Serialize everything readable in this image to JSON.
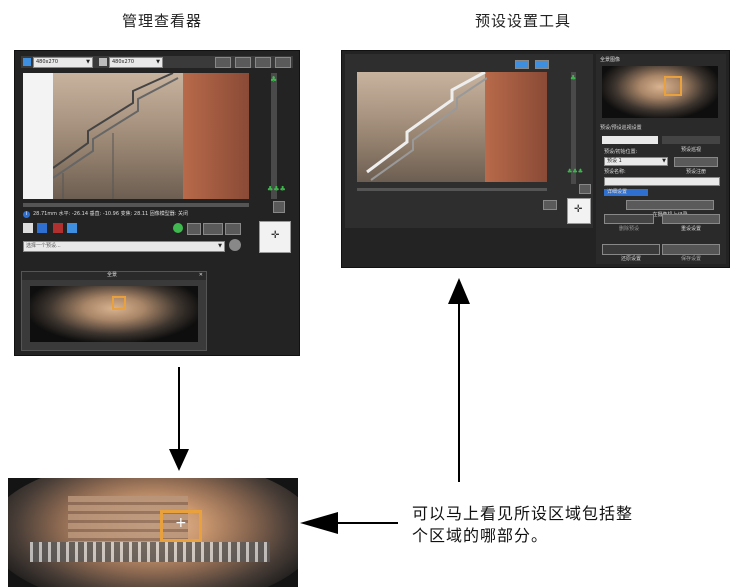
{
  "headings": {
    "left": "管理查看器",
    "right": "预设设置工具"
  },
  "viewer": {
    "size_select_1": "480x270",
    "size_select_2": "480x270",
    "status_line": "28.71mm 水平: -26.14 垂直: -10.96 变焦: 28.11 固像模型器: 关闭",
    "preset_select": "选择一个预设...",
    "panorama_title": "全景"
  },
  "preset_tool": {
    "panorama_title": "全景图像",
    "section_title": "预设/预设巡视设置",
    "tabs": [
      "预设",
      "预设巡视"
    ],
    "preset_label": "预设/初始位置:",
    "preset_value": "预设 1",
    "go_button": "预设注册",
    "name_label": "预设名称:",
    "detail_link": "详细设置",
    "camera_btn": "在摄像机上记录",
    "delete_btn": "删除预设",
    "reset_btn": "重设设置",
    "apply_btn": "还原设置",
    "save_btn": "保存设置"
  },
  "callout": {
    "line1": "可以马上看见所设区域包括整",
    "line2": "个区域的哪部分。"
  },
  "colors": {
    "window_bg": "#232323",
    "highlight": "#e8a13c",
    "accent_green": "#3fb94f",
    "accent_blue": "#2f6fd0"
  }
}
